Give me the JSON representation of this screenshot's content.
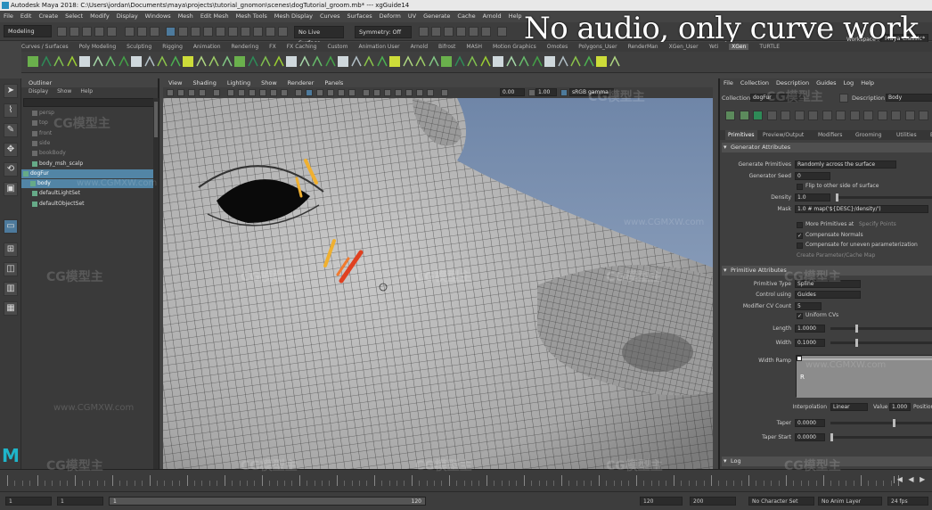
{
  "window": {
    "title": "Autodesk Maya 2018: C:\\Users\\jordan\\Documents\\maya\\projects\\tutorial_gnomon\\scenes\\dogTutorial_groom.mb*   ---   xgGuide14"
  },
  "overlay": {
    "text": "No audio, only curve work"
  },
  "menubar": {
    "items": [
      "File",
      "Edit",
      "Create",
      "Select",
      "Modify",
      "Display",
      "Windows",
      "Mesh",
      "Edit Mesh",
      "Mesh Tools",
      "Mesh Display",
      "Curves",
      "Surfaces",
      "Deform",
      "UV",
      "Generate",
      "Cache",
      "Arnold",
      "Help"
    ]
  },
  "statusline": {
    "mode": "Modeling",
    "live_surface": "No Live Surface",
    "symmetry": "Symmetry: Off",
    "workspace_label": "Workspace :",
    "workspace": "Maya Classic*"
  },
  "shelf": {
    "tabs": [
      "Curves / Surfaces",
      "Poly Modeling",
      "Sculpting",
      "Rigging",
      "Animation",
      "Rendering",
      "FX",
      "FX Caching",
      "Custom",
      "Animation User",
      "Arnold",
      "Bifrost",
      "MASH",
      "Motion Graphics",
      "Omotes",
      "Polygons_User",
      "RenderMan",
      "XGen_User",
      "Yeti",
      "XGen",
      "TURTLE"
    ],
    "active_tab": "XGen"
  },
  "outliner": {
    "title": "Outliner",
    "menu": [
      "Display",
      "Show",
      "Help"
    ],
    "items": [
      {
        "label": "persp",
        "dim": true
      },
      {
        "label": "top",
        "dim": true
      },
      {
        "label": "front",
        "dim": true
      },
      {
        "label": "side",
        "dim": true
      },
      {
        "label": "bookBody",
        "dim": true
      },
      {
        "label": "body_msh_scalp",
        "dim": false
      },
      {
        "label": "dogFur",
        "dim": false
      },
      {
        "label": "body",
        "dim": false
      },
      {
        "label": "defaultLightSet",
        "dim": false
      },
      {
        "label": "defaultObjectSet",
        "dim": false
      }
    ]
  },
  "viewport": {
    "menu": [
      "View",
      "Shading",
      "Lighting",
      "Show",
      "Renderer",
      "Panels"
    ],
    "exposure": "0.00",
    "gamma": "1.00",
    "color_space": "sRGB gamma"
  },
  "xgen": {
    "menu": [
      "File",
      "Collection",
      "Description",
      "Guides",
      "Log",
      "Help"
    ],
    "collection_label": "Collection",
    "collection": "dogFur",
    "description_label": "Description",
    "description": "Body",
    "tabs": [
      "Primitives",
      "Preview/Output",
      "Modifiers",
      "Grooming",
      "Utilities",
      "Expressions"
    ],
    "active_tab": "Primitives",
    "generator_section": "Generator Attributes",
    "generate_primitives_label": "Generate Primitives",
    "generate_primitives": "Randomly across the surface",
    "generator_seed_label": "Generator Seed",
    "generator_seed": "0",
    "flip_label": "Flip to other side of surface",
    "density_label": "Density",
    "density": "1.0",
    "mask_label": "Mask",
    "mask": "1.0 # map('${DESC}/density/')",
    "more_primitives_label": "More Primitives at",
    "more_primitives_dim": "Specify Points",
    "compensate_normals": "Compensate Normals",
    "compensate_uneven": "Compensate for uneven parameterization",
    "create_link": "Create Parameter/Cache Map",
    "primitive_section": "Primitive Attributes",
    "primitive_type_label": "Primitive Type",
    "primitive_type": "Spline",
    "control_using_label": "Control using",
    "control_using": "Guides",
    "modifier_cv_label": "Modifier CV Count",
    "modifier_cv": "5",
    "uniform_cvs": "Uniform CVs",
    "length_label": "Length",
    "length": "1.0000",
    "width_label": "Width",
    "width": "0.1000",
    "width_ramp_label": "Width Ramp",
    "ramp_letter": "R",
    "interpolation_label": "Interpolation",
    "interpolation": "Linear",
    "value_label": "Value",
    "value": "1.000",
    "position_label": "Position",
    "taper_label": "Taper",
    "taper": "0.0000",
    "taper_start_label": "Taper Start",
    "taper_start": "0.0000",
    "log_section": "Log"
  },
  "timeline": {
    "tick_labels": [
      "1",
      "5",
      "10",
      "15",
      "20",
      "25",
      "30",
      "35",
      "40",
      "45",
      "50",
      "55",
      "60",
      "65",
      "70",
      "75",
      "80",
      "85",
      "90",
      "95",
      "100",
      "105",
      "110",
      "115",
      "120"
    ]
  },
  "rangebar": {
    "start": "1",
    "start2": "1",
    "slider_start": "1",
    "slider_end": "120",
    "end": "120",
    "end2": "200",
    "character_set": "No Character Set",
    "anim_layer": "No Anim Layer",
    "fps": "24 fps"
  },
  "watermarks": [
    "CG模型主",
    "www.CGMXW.com"
  ]
}
